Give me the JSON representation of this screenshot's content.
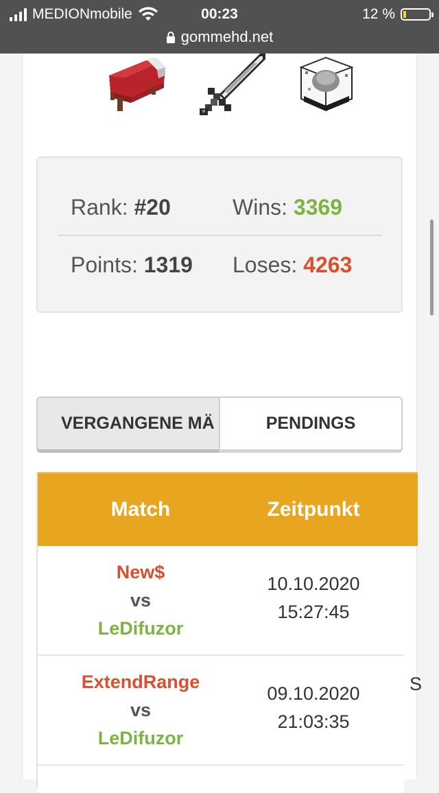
{
  "status_bar": {
    "carrier": "MEDIONmobile",
    "time": "00:23",
    "battery_percent": "12 %",
    "battery_level": 0.12,
    "url": "gommehd.net"
  },
  "game_icons": [
    "bed-icon",
    "sword-icon",
    "glass-block-icon"
  ],
  "stats": {
    "rank_label": "Rank:",
    "rank_value": "#20",
    "wins_label": "Wins:",
    "wins_value": "3369",
    "points_label": "Points:",
    "points_value": "1319",
    "loses_label": "Loses:",
    "loses_value": "4263"
  },
  "tabs": [
    {
      "label": "VERGANGENE MÄ",
      "active": true
    },
    {
      "label": "PENDINGS",
      "active": false
    }
  ],
  "table": {
    "headers": [
      "Match",
      "Zeitpunkt"
    ],
    "rows": [
      {
        "player1": "New$",
        "vs": "vs",
        "player2": "LeDifuzor",
        "date": "10.10.2020",
        "time": "15:27:45"
      },
      {
        "player1": "ExtendRange",
        "vs": "vs",
        "player2": "LeDifuzor",
        "date": "09.10.2020",
        "time": "21:03:35"
      }
    ],
    "clipped_text": "S"
  },
  "colors": {
    "header_orange": "#e8a620",
    "win_green": "#7db340",
    "lose_red": "#d9502f",
    "status_bar_bg": "#515151"
  }
}
